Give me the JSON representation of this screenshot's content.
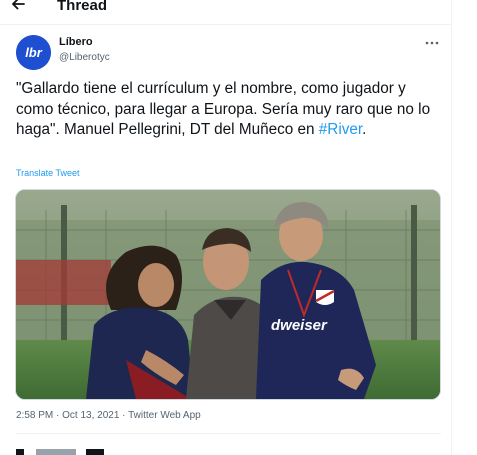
{
  "header": {
    "title": "Thread"
  },
  "author": {
    "name": "Líbero",
    "handle": "@Liberotyc",
    "avatar_text": "lbr"
  },
  "tweet": {
    "text_main": "\"Gallardo tiene el currículum y el nombre, como jugador y como técnico, para llegar a Europa. Sería muy raro que no lo haga\". Manuel Pellegrini, DT del Muñeco en ",
    "hashtag": "#River",
    "text_end": ".",
    "translate_label": "Translate Tweet",
    "timestamp": "2:58 PM · Oct 13, 2021 · Twitter Web App"
  },
  "photo": {
    "shirt_text": "dweiser"
  },
  "colors": {
    "accent": "#1d9bf0",
    "avatar_bg": "#1d4fd0",
    "text_primary": "#0f1419",
    "text_secondary": "#536471"
  },
  "icons": {
    "back": "arrow-left-icon",
    "more": "more-horizontal-icon"
  }
}
